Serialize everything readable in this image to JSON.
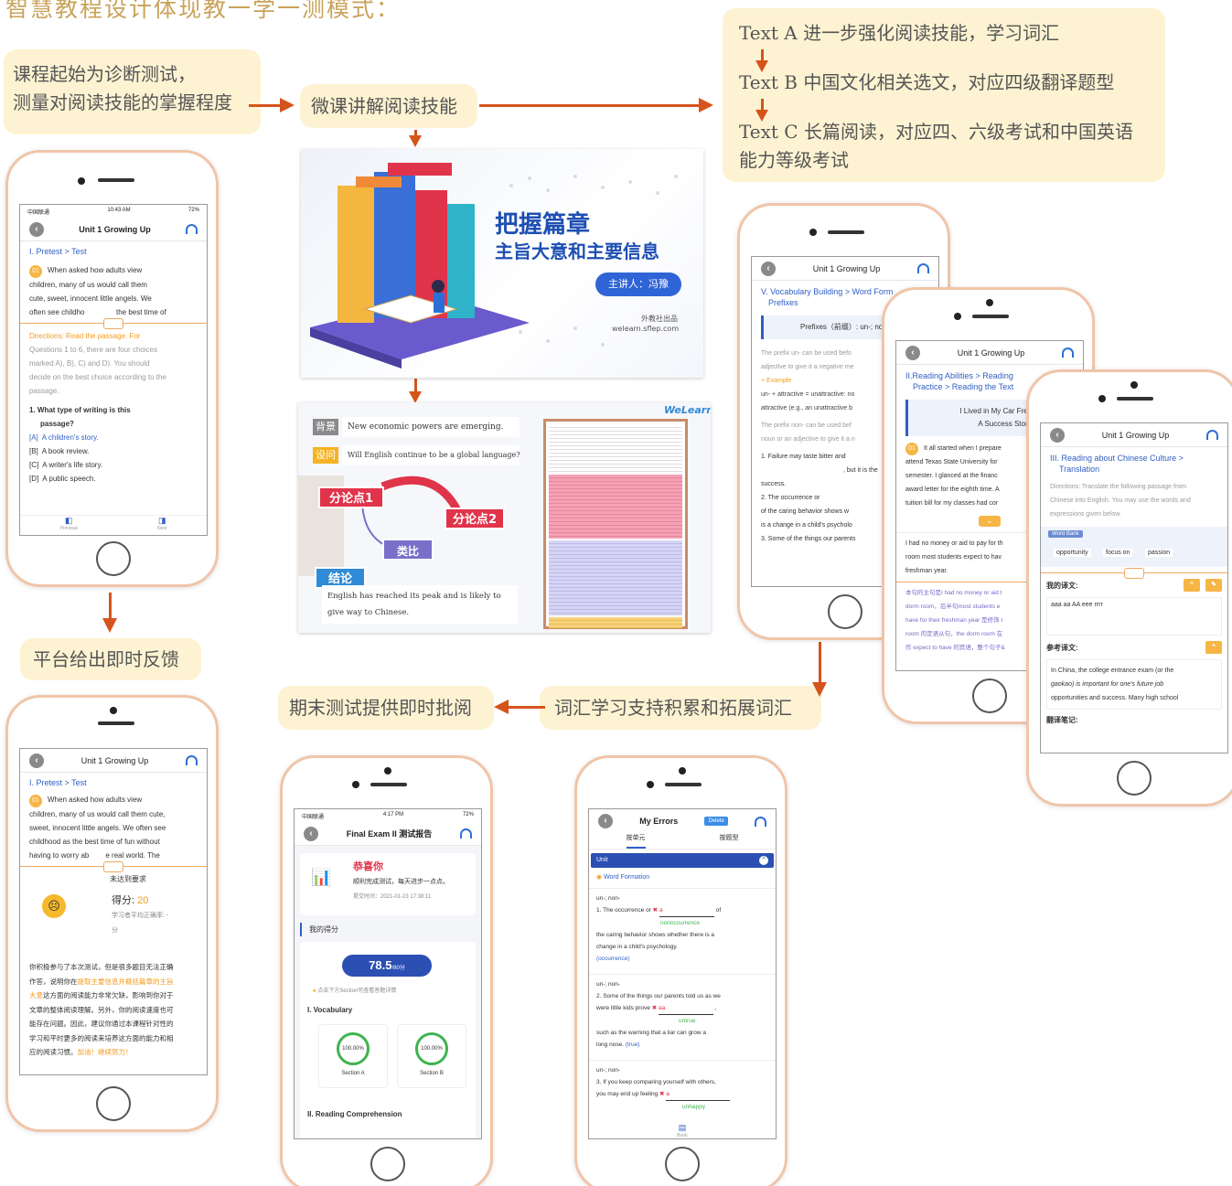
{
  "title": "智慧教程设计体现教一学一测模式：",
  "flow": {
    "diagnostic": [
      "课程起始为诊断测试，",
      "测量对阅读技能的掌握程度"
    ],
    "micro_lecture": "微课讲解阅读技能",
    "texts": {
      "text_a": "Text A 进一步强化阅读技能，学习词汇",
      "text_b": "Text B 中国文化相关选文，对应四级翻译题型",
      "text_c_1": "Text C 长篇阅读，对应四、六级考试和中国英语",
      "text_c_2": "能力等级考试"
    },
    "feedback": "平台给出即时反馈",
    "final_exam": "期末测试提供即时批阅",
    "vocab": "词汇学习支持积累和拓展词汇"
  },
  "slide1": {
    "headline_1": "把握篇章",
    "headline_2": "主旨大意和主要信息",
    "presenter": "主讲人：冯豫",
    "publisher": "外教社出品",
    "site": "welearn.sflep.com"
  },
  "slide2": {
    "brand": "WeLearn",
    "tag_background": "背景",
    "background_text": "New economic powers are emerging.",
    "tag_question": "设问",
    "question_text": "Will English continue to be a global language?",
    "point1": "分论点1",
    "point2": "分论点2",
    "analogy": "类比",
    "tag_conclusion": "结论",
    "conclusion_text": [
      "English has reached its peak and is likely to",
      "give way to Chinese."
    ]
  },
  "phone1": {
    "carrier": "中国联通",
    "time": "10:43 AM",
    "battery": "72%",
    "header": "Unit 1 Growing Up",
    "section": "I. Pretest > Test",
    "q_number": "01",
    "passage": [
      "When asked how adults view",
      "children, many of us would call them",
      "cute, sweet, innocent little angels. We",
      "often see childho",
      "the best time of"
    ],
    "directions": [
      "Directions: Read the passage. For",
      "Questions 1 to 6, there are four choices",
      "marked A), B), C) and D). You should",
      "decide on the best choice according to the",
      "passage."
    ],
    "question": [
      "1.  What type of writing is this",
      "passage?"
    ],
    "options": [
      {
        "letter": "[A]",
        "text": "A children's story."
      },
      {
        "letter": "[B]",
        "text": "A book review."
      },
      {
        "letter": "[C]",
        "text": "A writer's life story."
      },
      {
        "letter": "[D]",
        "text": "A public speech."
      }
    ],
    "prev": "Previous",
    "next": "Next"
  },
  "phone2": {
    "header": "Unit 1 Growing Up",
    "section": "I. Pretest > Test",
    "q_number": "01",
    "passage": [
      "When asked how adults view",
      "children, many of us would call them cute,",
      "sweet, innocent little angels. We often see",
      "childhood as the best time of fun without",
      "having to worry ab",
      "e real world. The"
    ],
    "not_met": "未达到要求",
    "score_label": "得分:",
    "score_value": "20",
    "avg": "学习者平均正确率: -",
    "avg_unit": "分",
    "feedback": [
      "你积极参与了本次测试，但是很多题目无法正确",
      "作答，说明你在",
      "提取主要信息并概括篇章的主旨",
      "大意",
      "这方面的阅读能力非常欠缺，影响到你对于",
      "文章的整体阅读理解。另外，你的阅读速度也可",
      "能存在问题。因此，建议你通过本课程针对性的",
      "学习和平时更多的阅读来培养这方面的能力和相",
      "应的阅读习惯。",
      "加油！继续努力！"
    ]
  },
  "phone3": {
    "carrier": "中国联通",
    "time": "4:17 PM",
    "battery": "72%",
    "header": "Final Exam II 测试报告",
    "congrats": "恭喜你",
    "done": "顺利完成测试，每天进步一点点。",
    "submit_time": "提交时间：2021-01-23 17:38:11",
    "my_score": "我的得分",
    "score": "78.5",
    "score_unit": "/80分",
    "tip": "点击下方Section可查看答题详情",
    "vocab": "I. Vocabulary",
    "sec_a_pct": "100.00%",
    "sec_a": "Section A",
    "sec_b_pct": "100.00%",
    "sec_b": "Section B",
    "reading": "II. Reading Comprehension"
  },
  "phone4": {
    "header": "My Errors",
    "delete": "Delete",
    "tab_unit": "按单元",
    "tab_type": "按题型",
    "unit": "Unit",
    "category": "Word Formation",
    "items": [
      {
        "prefix": "un-; non-",
        "q": "1.  The occurrence or",
        "ans": "a",
        "tail": "of",
        "correct": "nonoccurrence",
        "rest": [
          "the caring behavior shows whether there is a",
          "change in a child's psychology."
        ],
        "hint": "(occurrence)"
      },
      {
        "prefix": "un-; non-",
        "q": "2.  Some of the things our parents told us as we",
        "q2": "were little kids prove",
        "ans": "aa",
        "tail": ",",
        "correct": "untrue",
        "rest": [
          "such as the warning that a liar can grow a",
          "long nose."
        ],
        "hint": "(true)"
      },
      {
        "prefix": "un-; non-",
        "q": "3.  If you keep comparing yourself with others,",
        "q2": "you may end up feeling",
        "ans": "a",
        "tail": "",
        "correct": "unhappy",
        "rest": [],
        "hint": ""
      }
    ],
    "book": "Book"
  },
  "phone5": {
    "header": "Unit 1 Growing Up",
    "section": [
      "V. Vocabulary Building > Word Form",
      "Prefixes"
    ],
    "box": "Prefixes（前缀）: un-; no",
    "p1": [
      "The prefix un- can be used befo",
      "adjective to give it a negative me"
    ],
    "example": "Example",
    "ex": [
      "un- + attractive = unattractive: no",
      "attractive (e.g., an unattractive b"
    ],
    "p2": [
      "The prefix non- can be used bef",
      "noun or an adjective to give it a n"
    ],
    "q1": [
      "1.  Failure may taste bitter and",
      ", but it is the",
      "success."
    ],
    "q2": [
      "2.  The occurrence or",
      "of the caring behavior shows w",
      "is a change in a child's psycholo"
    ],
    "q3": "3.  Some of the things our parents"
  },
  "phone6": {
    "header": "Unit 1 Growing Up",
    "section": [
      "II.Reading Abilities > Reading",
      "Practice > Reading the Text"
    ],
    "box": [
      "I Lived in My Car Freshman",
      "A Success Story"
    ],
    "q_number": "01",
    "passage": [
      "It all started when I prepare",
      "attend Texas State University for",
      "semester. I glanced at the financ",
      "award letter for the eighth time. A",
      "tuition bill for my classes had cor"
    ],
    "passage2": [
      "I had no money or aid to pay for th",
      "room most students expect to hav",
      "freshman year."
    ],
    "notes": [
      "本句的主句是I had no money or aid t",
      "dorm room，后半句most students e",
      "have for their freshman year 是修饰 t",
      "room 的定语从句，the dorm room 在",
      "作 expect to have 的宾语，整个句子&"
    ]
  },
  "phone7": {
    "header": "Unit 1 Growing Up",
    "section": [
      "III. Reading about Chinese Culture >",
      "Translation"
    ],
    "directions": [
      "Directions: Translate the following passage from",
      "Chinese into English. You may use the words and",
      "expressions given below."
    ],
    "word_bank": "Word Bank",
    "words": [
      "opportunity",
      "focus on",
      "passion"
    ],
    "my_translation": "我的译文:",
    "my_text": "aaa aa AA eee rrrr",
    "reference": "参考译文:",
    "ref_text": [
      "In China, the college entrance exam (or the",
      "gaokao) is important for one's future job",
      "opportunities and success. Many high school"
    ],
    "notes": "翻译笔记:"
  },
  "colors": {
    "accent": "#d5541c",
    "box_bg": "#fdf3d2",
    "phone_frame": "#f0c5a8",
    "link_blue": "#2f5fc4"
  }
}
